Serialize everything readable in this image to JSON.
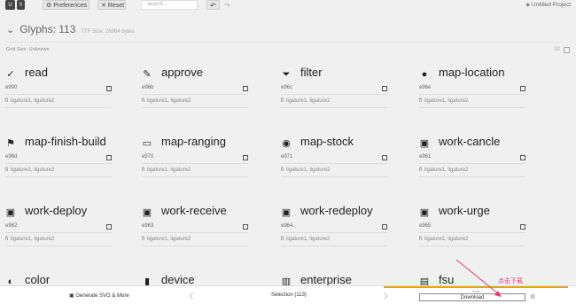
{
  "topbar": {
    "logo": "U",
    "preferences": "Preferences",
    "reset": "Reset",
    "search_placeholder": "search...",
    "undo": "↶",
    "redo": "↷",
    "project": "Untitled Project"
  },
  "set": {
    "title": "Glyphs: 113",
    "ttf": "TTF Size: 26064 bytes",
    "grid_size": "Grid Size: Unknown",
    "grid_num": "32"
  },
  "glyphs": [
    {
      "name": "read",
      "code": "e900",
      "lig": "ligature1, ligature2",
      "icon": "✓"
    },
    {
      "name": "approve",
      "code": "e96b",
      "lig": "ligature1, ligature2",
      "icon": "✎"
    },
    {
      "name": "filter",
      "code": "e96c",
      "lig": "ligature1, ligature2",
      "icon": "⏷"
    },
    {
      "name": "map-location",
      "code": "e96e",
      "lig": "ligature1, ligature2",
      "icon": "●"
    },
    {
      "name": "map-finish-build",
      "code": "e96d",
      "lig": "ligature1, ligature2",
      "icon": "⚑"
    },
    {
      "name": "map-ranging",
      "code": "e970",
      "lig": "ligature1, ligature2",
      "icon": "▭"
    },
    {
      "name": "map-stock",
      "code": "e971",
      "lig": "ligature1, ligature2",
      "icon": "◉"
    },
    {
      "name": "work-cancle",
      "code": "e961",
      "lig": "ligature1, ligature2",
      "icon": "▣"
    },
    {
      "name": "work-deploy",
      "code": "e962",
      "lig": "ligature1, ligature2",
      "icon": "▣"
    },
    {
      "name": "work-receive",
      "code": "e963",
      "lig": "ligature1, ligature2",
      "icon": "▣"
    },
    {
      "name": "work-redeploy",
      "code": "e964",
      "lig": "ligature1, ligature2",
      "icon": "▣"
    },
    {
      "name": "work-urge",
      "code": "e965",
      "lig": "ligature1, ligature2",
      "icon": "▣"
    },
    {
      "name": "color",
      "code": "",
      "lig": "",
      "icon": "◐"
    },
    {
      "name": "device",
      "code": "",
      "lig": "",
      "icon": "▮"
    },
    {
      "name": "enterprise",
      "code": "",
      "lig": "",
      "icon": "▥"
    },
    {
      "name": "fsu",
      "code": "",
      "lig": "",
      "icon": "▤"
    }
  ],
  "footer": {
    "generate": "Generate SVG & More",
    "selection": "Selection (113)",
    "font_label": "Font",
    "download": "Download"
  },
  "annotation": "点击下载",
  "colors": {
    "accent": "#e8a020",
    "annotation": "#e83d6c"
  }
}
